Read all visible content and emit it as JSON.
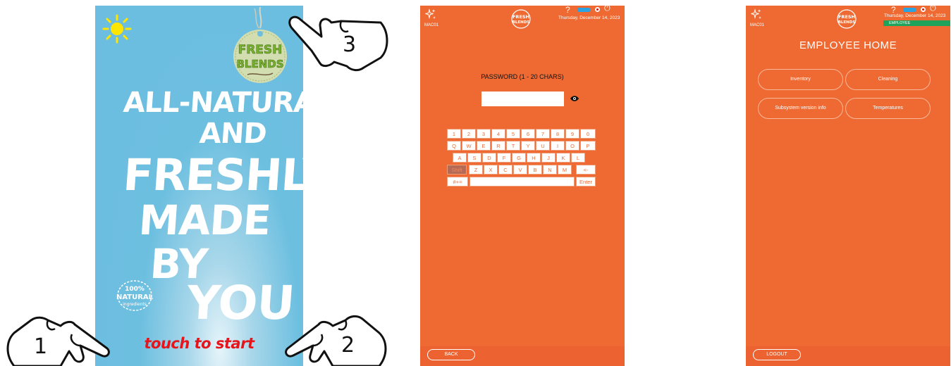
{
  "splash": {
    "tag_line1": "FRESH",
    "tag_line2": "BLENDS",
    "headline": [
      "ALL-NATURAL",
      "AND",
      "FRESHLY",
      "MADE",
      "BY",
      "YOU"
    ],
    "badge_line1": "100%",
    "badge_line2": "NATURAL",
    "badge_line3": "ingredients",
    "touch_label": "touch to start"
  },
  "callouts": [
    "1",
    "2",
    "3"
  ],
  "header": {
    "machine_id": "MAC01",
    "logo_line1": "FRESH",
    "logo_line2": "BLENDS",
    "help": "?",
    "power": "⏻",
    "datetime": "Thursday, December 14, 2023"
  },
  "password_screen": {
    "title": "PASSWORD (1 - 20 CHARS)",
    "input_value": "",
    "keyboard": {
      "row1": [
        "1",
        "2",
        "3",
        "4",
        "5",
        "6",
        "7",
        "8",
        "9",
        "0"
      ],
      "row2": [
        "Q",
        "W",
        "E",
        "R",
        "T",
        "Y",
        "U",
        "I",
        "O",
        "P"
      ],
      "row3": [
        "A",
        "S",
        "D",
        "F",
        "G",
        "H",
        "J",
        "K",
        "L"
      ],
      "row4": [
        "Shift",
        "Z",
        "X",
        "C",
        "V",
        "B",
        "N",
        "M",
        "<-"
      ],
      "symbols": "#+=",
      "enter": "Enter"
    },
    "back_label": "BACK"
  },
  "employee_screen": {
    "role_badge": "EMPLOYEE",
    "title": "EMPLOYEE HOME",
    "buttons": [
      "Inventory",
      "Cleaning",
      "Subsystem version info",
      "Temperatures"
    ],
    "logout_label": "LOGOUT"
  },
  "colors": {
    "screen_orange": "#ef6a32",
    "splash_blue": "#6cbde0",
    "touch_red": "#e6151c",
    "employee_green": "#1fa35a",
    "battery_blue": "#2aa3e0"
  }
}
